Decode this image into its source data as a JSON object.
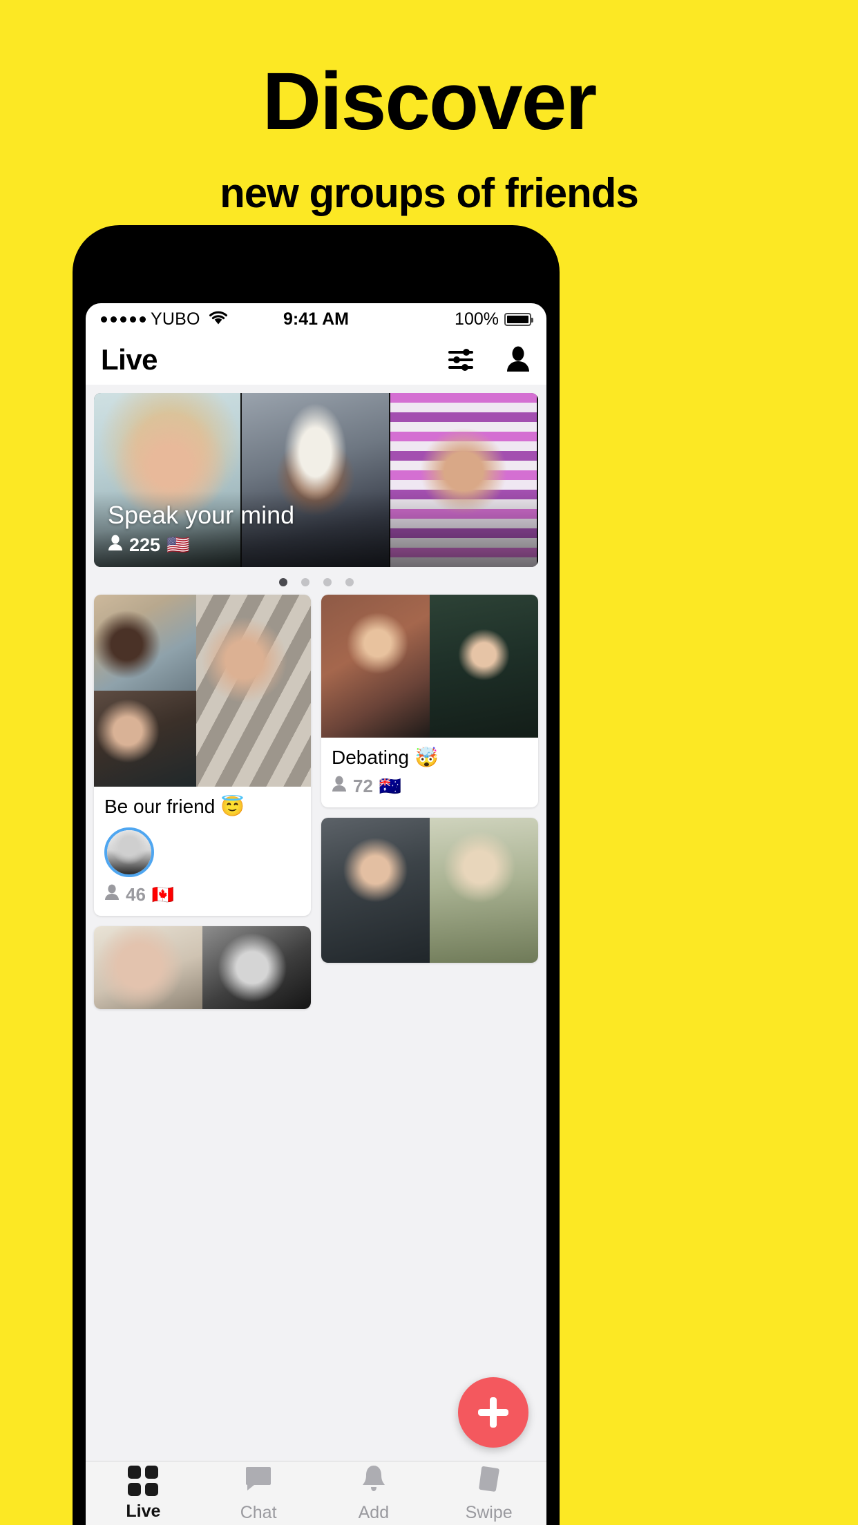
{
  "promo": {
    "title": "Discover",
    "subtitle": "new groups of friends"
  },
  "colors": {
    "background_yellow": "#FCE824",
    "fab_red": "#F4585E",
    "avatar_ring_blue": "#4FA6F0",
    "active_dot": "#4A4A4F",
    "inactive_dot": "#C3C3C6",
    "muted_text": "#9A9A9F"
  },
  "status_bar": {
    "signal_dots": 5,
    "carrier": "YUBO",
    "wifi_icon": "wifi-icon",
    "time": "9:41 AM",
    "battery_percent": "100%",
    "battery_icon": "battery-full-icon"
  },
  "nav": {
    "title": "Live",
    "filter_icon": "sliders-icon",
    "profile_icon": "person-icon"
  },
  "hero": {
    "title": "Speak your mind",
    "viewer_icon": "person-filled-icon",
    "viewers": "225",
    "flag": "🇺🇸",
    "panes": [
      "participant-1",
      "participant-2",
      "participant-3"
    ],
    "page_dots": {
      "count": 4,
      "active_index": 0
    }
  },
  "cards": [
    {
      "id": "be-our-friend",
      "title": "Be our friend",
      "emoji": "😇",
      "viewer_icon": "person-filled-icon",
      "viewers": "46",
      "flag": "🇨🇦",
      "has_avatar": true,
      "layout": "collage-3"
    },
    {
      "id": "debating",
      "title": "Debating",
      "emoji": "🤯",
      "viewer_icon": "person-filled-icon",
      "viewers": "72",
      "flag": "🇦🇺",
      "has_avatar": false,
      "layout": "split-2"
    }
  ],
  "fab": {
    "icon": "plus-icon",
    "label": "+"
  },
  "tabbar": {
    "items": [
      {
        "label": "Live",
        "icon": "grid-squares-icon",
        "active": true
      },
      {
        "label": "Chat",
        "icon": "chat-bubble-icon",
        "active": false
      },
      {
        "label": "Add",
        "icon": "bell-icon",
        "active": false
      },
      {
        "label": "Swipe",
        "icon": "card-swipe-icon",
        "active": false
      }
    ]
  }
}
